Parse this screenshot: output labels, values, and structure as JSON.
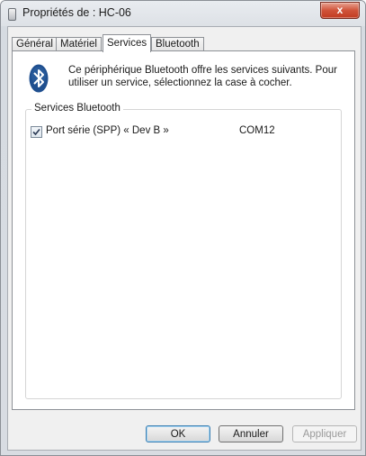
{
  "window": {
    "title": "Propriétés de : HC-06",
    "close_label": "x"
  },
  "tabs": [
    {
      "label": "Général",
      "active": false
    },
    {
      "label": "Matériel",
      "active": false
    },
    {
      "label": "Services",
      "active": true
    },
    {
      "label": "Bluetooth",
      "active": false
    }
  ],
  "services_tab": {
    "description": "Ce périphérique Bluetooth offre les services suivants. Pour utiliser un service, sélectionnez la case à cocher.",
    "group_label": "Services Bluetooth",
    "services": [
      {
        "name": "Port série (SPP) « Dev B »",
        "port": "COM12",
        "checked": true
      }
    ]
  },
  "buttons": {
    "ok": "OK",
    "cancel": "Annuler",
    "apply": "Appliquer"
  },
  "colors": {
    "bluetooth_icon": "#1f4f8f",
    "close_button": "#c94a31",
    "primary_button_border": "#3c7fb1"
  },
  "icons": {
    "title": "device-icon",
    "service": "bluetooth-icon",
    "close": "close-icon",
    "check": "checkmark-icon"
  }
}
